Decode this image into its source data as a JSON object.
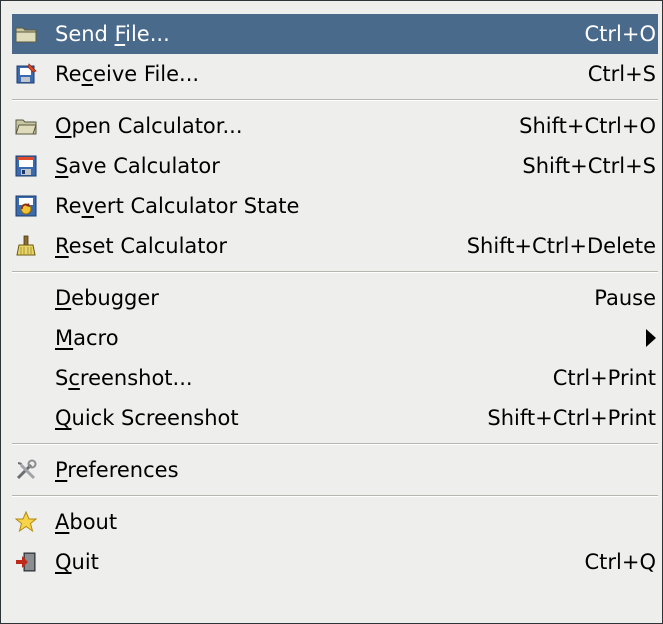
{
  "menu": {
    "items": [
      {
        "pre": "Send ",
        "u": "F",
        "post": "ile...",
        "accel": "Ctrl+O",
        "icon": "folder-icon"
      },
      {
        "pre": "Re",
        "u": "c",
        "post": "eive File...",
        "accel": "Ctrl+S",
        "icon": "receive-file-icon"
      },
      {
        "pre": "",
        "u": "O",
        "post": "pen Calculator...",
        "accel": "Shift+Ctrl+O",
        "icon": "open-folder-icon"
      },
      {
        "pre": "",
        "u": "S",
        "post": "ave Calculator",
        "accel": "Shift+Ctrl+S",
        "icon": "floppy-disk-icon"
      },
      {
        "pre": "Re",
        "u": "v",
        "post": "ert Calculator State",
        "accel": "",
        "icon": "revert-icon"
      },
      {
        "pre": "",
        "u": "R",
        "post": "eset Calculator",
        "accel": "Shift+Ctrl+Delete",
        "icon": "broom-icon"
      },
      {
        "pre": "",
        "u": "D",
        "post": "ebugger",
        "accel": "Pause",
        "icon": ""
      },
      {
        "pre": "",
        "u": "M",
        "post": "acro",
        "accel": "",
        "icon": ""
      },
      {
        "pre": "S",
        "u": "c",
        "post": "reenshot...",
        "accel": "Ctrl+Print",
        "icon": ""
      },
      {
        "pre": "",
        "u": "Q",
        "post": "uick Screenshot",
        "accel": "Shift+Ctrl+Print",
        "icon": ""
      },
      {
        "pre": "",
        "u": "P",
        "post": "references",
        "accel": "",
        "icon": "preferences-tools-icon"
      },
      {
        "pre": "",
        "u": "A",
        "post": "bout",
        "accel": "",
        "icon": "star-icon"
      },
      {
        "pre": "",
        "u": "Q",
        "post": "uit",
        "accel": "Ctrl+Q",
        "icon": "quit-exit-icon"
      }
    ]
  },
  "colors": {
    "highlight": "#4a6a8c",
    "menu_bg": "#eeeeec"
  }
}
